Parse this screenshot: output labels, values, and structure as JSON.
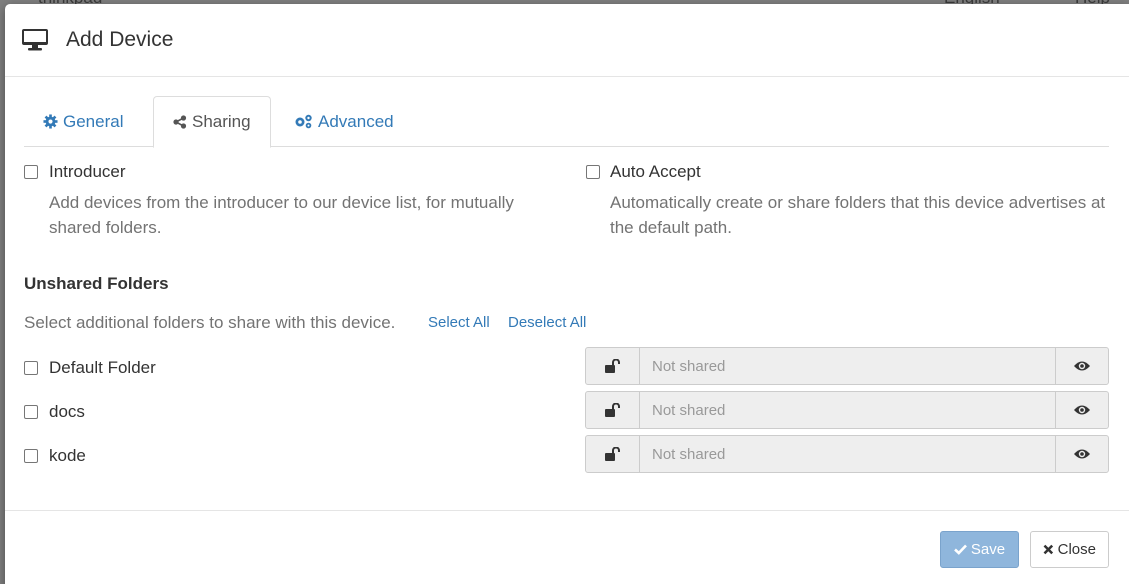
{
  "background": {
    "hostname": "thinkpad",
    "language": "English",
    "help": "Help"
  },
  "modal": {
    "title": "Add Device",
    "icon": "desktop-icon"
  },
  "tabs": [
    {
      "label": "General",
      "icon": "gear-icon",
      "active": false
    },
    {
      "label": "Sharing",
      "icon": "share-icon",
      "active": true
    },
    {
      "label": "Advanced",
      "icon": "gears-icon",
      "active": false
    }
  ],
  "options": {
    "introducer": {
      "label": "Introducer",
      "help": "Add devices from the introducer to our device list, for mutually shared folders.",
      "checked": false
    },
    "auto_accept": {
      "label": "Auto Accept",
      "help": "Automatically create or share folders that this device advertises at the default path.",
      "checked": false
    }
  },
  "unshared": {
    "title": "Unshared Folders",
    "description": "Select additional folders to share with this device.",
    "select_all": "Select All",
    "deselect_all": "Deselect All",
    "folders": [
      {
        "label": "Default Folder",
        "placeholder": "Not shared",
        "checked": false
      },
      {
        "label": "docs",
        "placeholder": "Not shared",
        "checked": false
      },
      {
        "label": "kode",
        "placeholder": "Not shared",
        "checked": false
      }
    ]
  },
  "footer": {
    "save_label": "Save",
    "close_label": "Close"
  },
  "colors": {
    "link": "#337ab7",
    "save_bg": "#8fb6dc",
    "muted": "#737373"
  }
}
